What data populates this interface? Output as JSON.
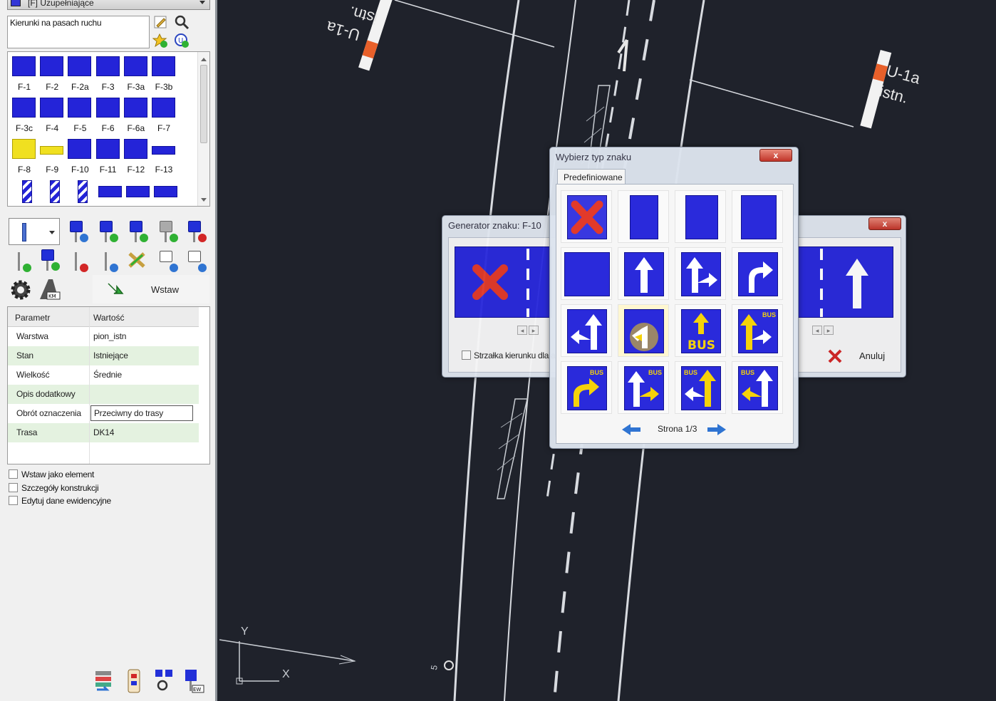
{
  "panel": {
    "category_dropdown": "[F] Uzupełniające",
    "category_field": "Kierunki na pasach ruchu",
    "signs": [
      {
        "code": "F-1"
      },
      {
        "code": "F-2"
      },
      {
        "code": "F-2a"
      },
      {
        "code": "F-3"
      },
      {
        "code": "F-3a"
      },
      {
        "code": "F-3b"
      },
      {
        "code": "F-3c"
      },
      {
        "code": "F-4"
      },
      {
        "code": "F-5"
      },
      {
        "code": "F-6"
      },
      {
        "code": "F-6a"
      },
      {
        "code": "F-7"
      },
      {
        "code": "F-8"
      },
      {
        "code": "F-9"
      },
      {
        "code": "F-10"
      },
      {
        "code": "F-11"
      },
      {
        "code": "F-12"
      },
      {
        "code": "F-13"
      }
    ],
    "insert_label": "Wstaw",
    "table": {
      "header_param": "Parametr",
      "header_value": "Wartość",
      "rows": [
        {
          "param": "Warstwa",
          "value": "pion_istn"
        },
        {
          "param": "Stan",
          "value": "Istniejące"
        },
        {
          "param": "Wielkość",
          "value": "Średnie"
        },
        {
          "param": "Opis dodatkowy",
          "value": ""
        },
        {
          "param": "Obrót oznaczenia",
          "value": "Przeciwny do trasy"
        },
        {
          "param": "Trasa",
          "value": "DK14"
        }
      ]
    },
    "checkboxes": {
      "insert_as_element": "Wstaw jako element",
      "construction_details": "Szczegóły konstrukcji",
      "edit_records": "Edytuj dane ewidencyjne"
    }
  },
  "canvas": {
    "label_left_1": "U-1a",
    "label_left_2": "istn.",
    "label_right_1": "U-1a",
    "label_right_2": "istn.",
    "axis_y": "Y",
    "axis_x": "X",
    "marker": "5"
  },
  "generator_dialog": {
    "title": "Generator znaku: F-10",
    "close_label": "x",
    "checkbox_label": "Strzałka kierunku dla a",
    "cancel_label": "Anuluj"
  },
  "type_dialog": {
    "title": "Wybierz typ znaku",
    "close_label": "x",
    "tab_label": "Predefiniowane",
    "page_label": "Strona 1/3",
    "bus_label": "BUS"
  },
  "colors": {
    "sign_blue": "#2a2adb",
    "canvas_bg": "#1f222b",
    "bus_yellow": "#f5d20a",
    "delete_red": "#e23a2a"
  }
}
